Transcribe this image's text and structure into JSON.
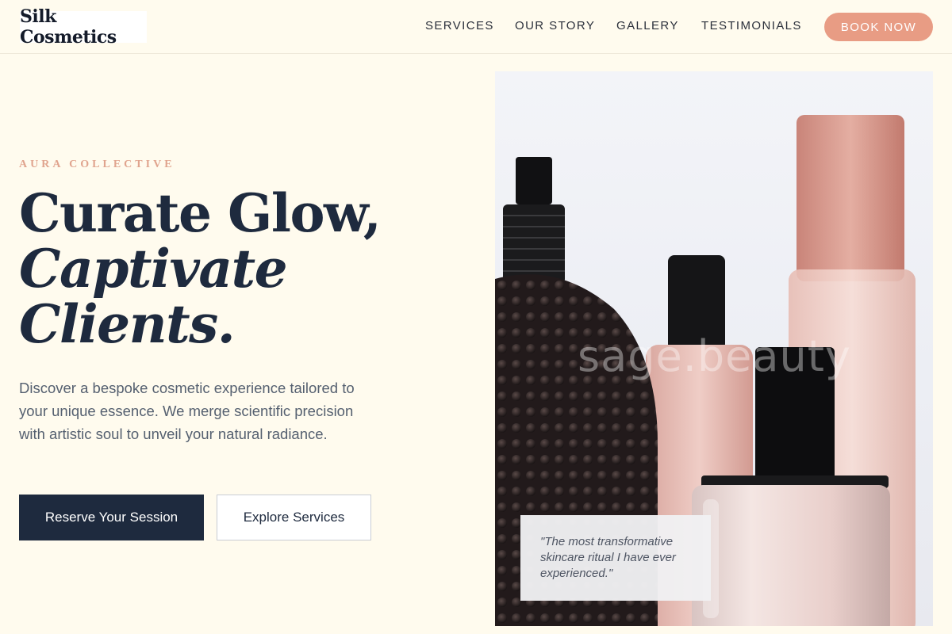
{
  "header": {
    "logo": "Silk Cosmetics",
    "nav": [
      "SERVICES",
      "OUR STORY",
      "GALLERY",
      "TESTIMONIALS"
    ],
    "cta": "BOOK NOW"
  },
  "hero": {
    "eyebrow": "AURA COLLECTIVE",
    "headline": {
      "line1": "Curate Glow,",
      "line2": "Captivate",
      "line3": "Clients."
    },
    "body": "Discover a bespoke cosmetic experience tailored to your unique essence. We merge scientific precision with artistic soul to unveil your natural radiance.",
    "primary_button": "Reserve Your Session",
    "secondary_button": "Explore Services"
  },
  "image": {
    "watermark": "sage.beauty",
    "quote": "\"The most transformative skincare ritual I have ever experienced.\""
  },
  "colors": {
    "background": "#fffbee",
    "navy": "#1e2a3e",
    "accent": "#e89c84",
    "eyebrow": "#e0a48e"
  }
}
